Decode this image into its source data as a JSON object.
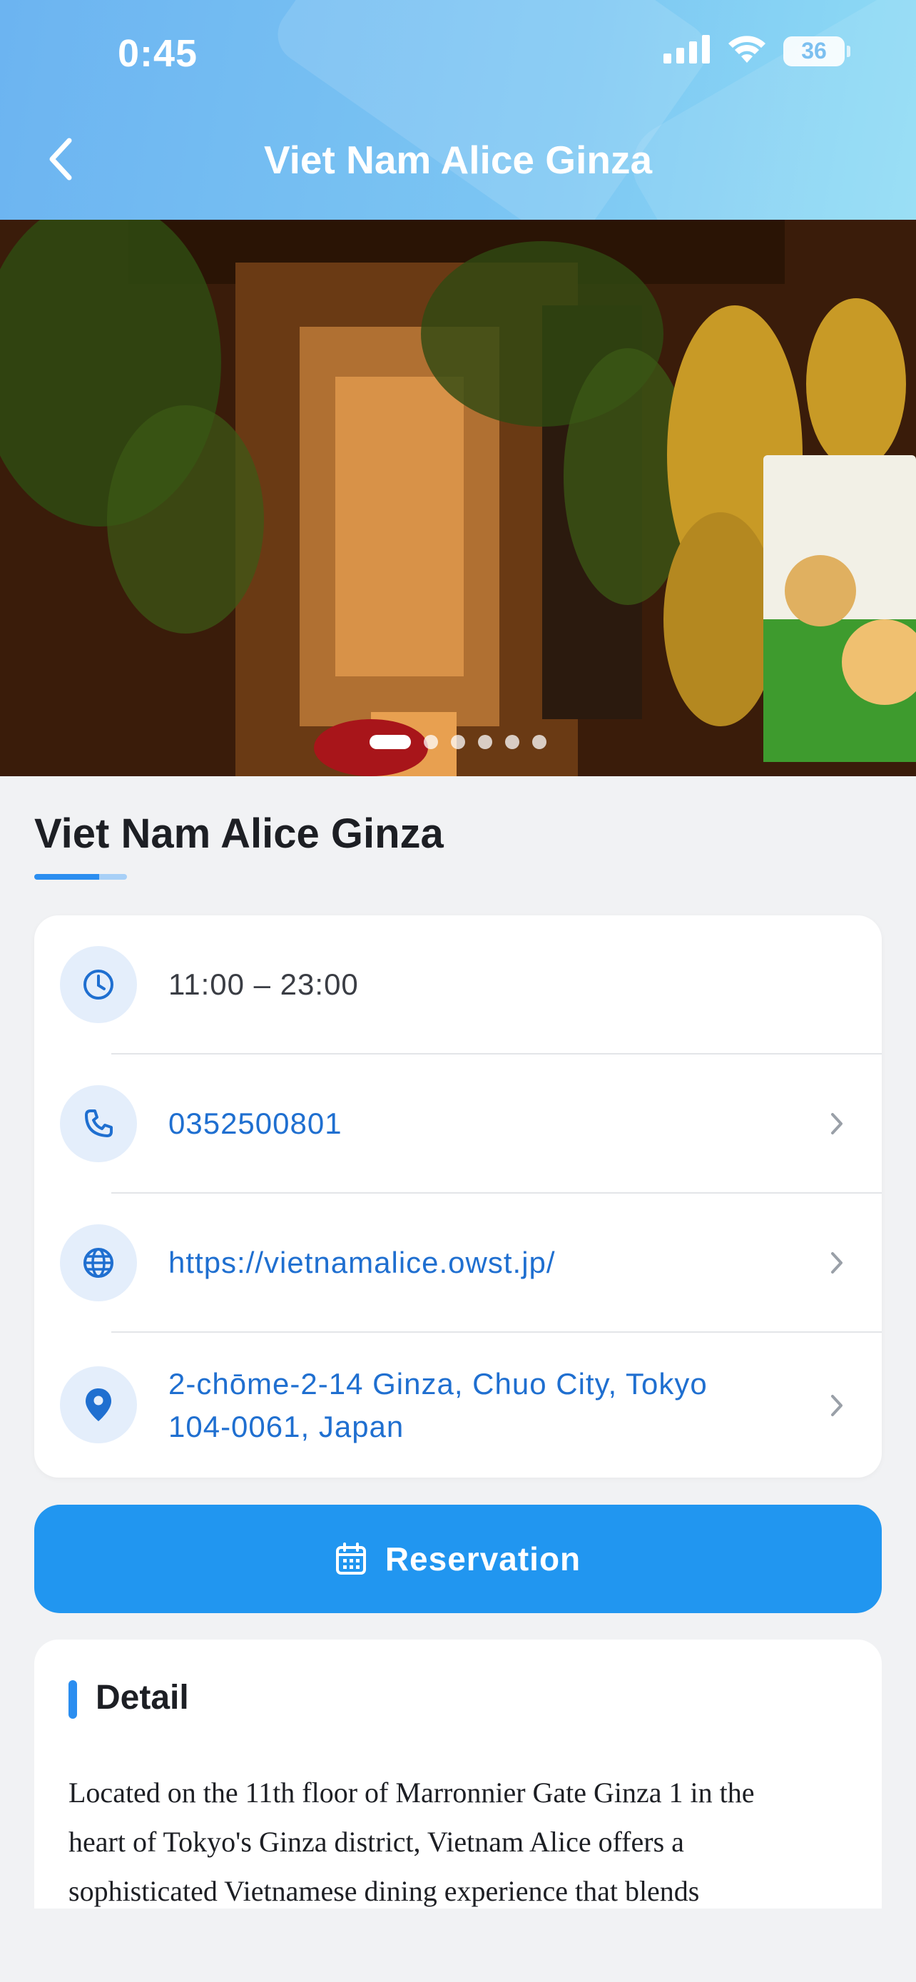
{
  "status_bar": {
    "time": "0:45",
    "battery": "36"
  },
  "header": {
    "title": "Viet Nam Alice Ginza"
  },
  "gallery": {
    "dot_count": 6,
    "active_index": 0
  },
  "place": {
    "name": "Viet Nam Alice Ginza"
  },
  "info": {
    "hours": "11:00 – 23:00",
    "phone": "0352500801",
    "website": "https://vietnamalice.owst.jp/",
    "address_line1": "2-chōme-2-14 Ginza, Chuo City, Tokyo",
    "address_line2": "104-0061, Japan"
  },
  "reservation": {
    "label": "Reservation"
  },
  "detail": {
    "title": "Detail",
    "lines": [
      "Located on the 11th floor of Marronnier Gate Ginza 1 in the",
      "heart of Tokyo's Ginza district, Vietnam Alice offers a",
      "sophisticated Vietnamese dining experience that blends"
    ]
  },
  "colors": {
    "accent": "#2196f0",
    "link": "#1f6fd0",
    "header_start": "#6cb4f1",
    "header_end": "#8fdcf4"
  },
  "icons": [
    "back-icon",
    "signal-icon",
    "wifi-icon",
    "battery-icon",
    "clock-icon",
    "phone-icon",
    "globe-icon",
    "location-pin-icon",
    "chevron-right-icon",
    "calendar-icon"
  ]
}
